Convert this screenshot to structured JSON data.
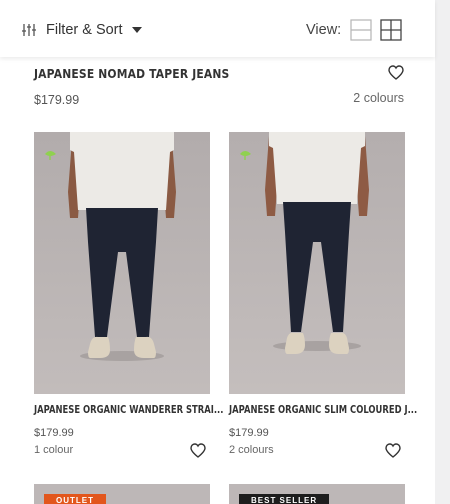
{
  "toolbar": {
    "filter_label": "Filter & Sort",
    "view_label": "View:"
  },
  "top_product": {
    "name": "JAPANESE NOMAD TAPER JEANS",
    "price": "$179.99",
    "colours": "2 colours"
  },
  "products": [
    {
      "name": "JAPANESE ORGANIC WANDERER STRAI...",
      "price": "$179.99",
      "colours": "1 colour"
    },
    {
      "name": "JAPANESE ORGANIC SLIM COLOURED J...",
      "price": "$179.99",
      "colours": "2 colours"
    }
  ],
  "bottom_products": [
    {
      "badge": "OUTLET"
    },
    {
      "badge": "BEST SELLER"
    }
  ],
  "colors": {
    "image_bg": "#b9b3b3",
    "eco_icon": "#8fd14f",
    "badge_outlet": "#e2561c",
    "badge_best_seller": "#1d1d1d",
    "jeans": "#1f2433"
  },
  "icons": {
    "filter": "sliders-icon",
    "caret": "caret-down-icon",
    "view_list": "single-column-view-icon",
    "view_grid": "grid-view-icon",
    "wishlist": "heart-icon",
    "eco": "leaf-icon"
  }
}
